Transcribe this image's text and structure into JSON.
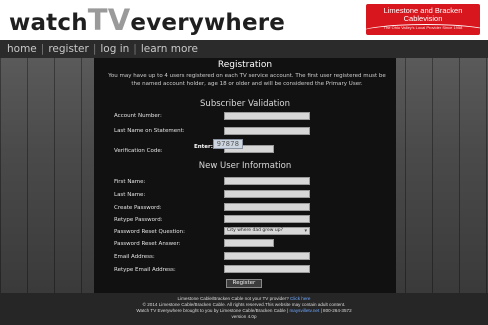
{
  "header": {
    "logo_part1": "watch",
    "logo_tv": "TV",
    "logo_part2": "everywhere",
    "brand_line1": "Limestone and Bracken",
    "brand_line2": "Cablevision",
    "brand_tagline": "The Ohio Valley's Local Provider Since 1958",
    "colors": {
      "brand_red": "#d8161e"
    }
  },
  "nav": {
    "items": [
      "home",
      "register",
      "log in",
      "learn more"
    ]
  },
  "panel": {
    "title": "Registration",
    "intro": "You may have up to 4 users registered on each TV service account. The first user registered must be the named account holder, age 18 or older and will be considered the Primary User.",
    "subscriber_validation": {
      "heading": "Subscriber Validation",
      "account_number_label": "Account Number:",
      "last_name_statement_label": "Last Name on Statement:",
      "verification_code_label": "Verification Code:",
      "enter_label": "Enter:",
      "captcha_code": "97878"
    },
    "new_user": {
      "heading": "New User Information",
      "first_name_label": "First Name:",
      "last_name_label": "Last Name:",
      "create_password_label": "Create Password:",
      "retype_password_label": "Retype Password:",
      "reset_question_label": "Password Reset Question:",
      "reset_question_selected": "City where dad grew up?",
      "reset_answer_label": "Password Reset Answer:",
      "email_label": "Email Address:",
      "retype_email_label": "Retype Email Address:"
    },
    "register_button": "Register"
  },
  "footer": {
    "line1_text": "Limestone Cable/Bracken Cable not your TV provider?",
    "line1_link": "Click here",
    "line2": "© 2014 Limestone Cable/Bracken Cable. All rights reserved.This website may contain adult content.",
    "line3_text": "Watch TV Everywhere brought to you by Limestone Cable/Bracken Cable |",
    "line3_link": "maysvilletv.net",
    "line3_phone": "| 800-264-3572",
    "line4": "version 4.0p"
  }
}
